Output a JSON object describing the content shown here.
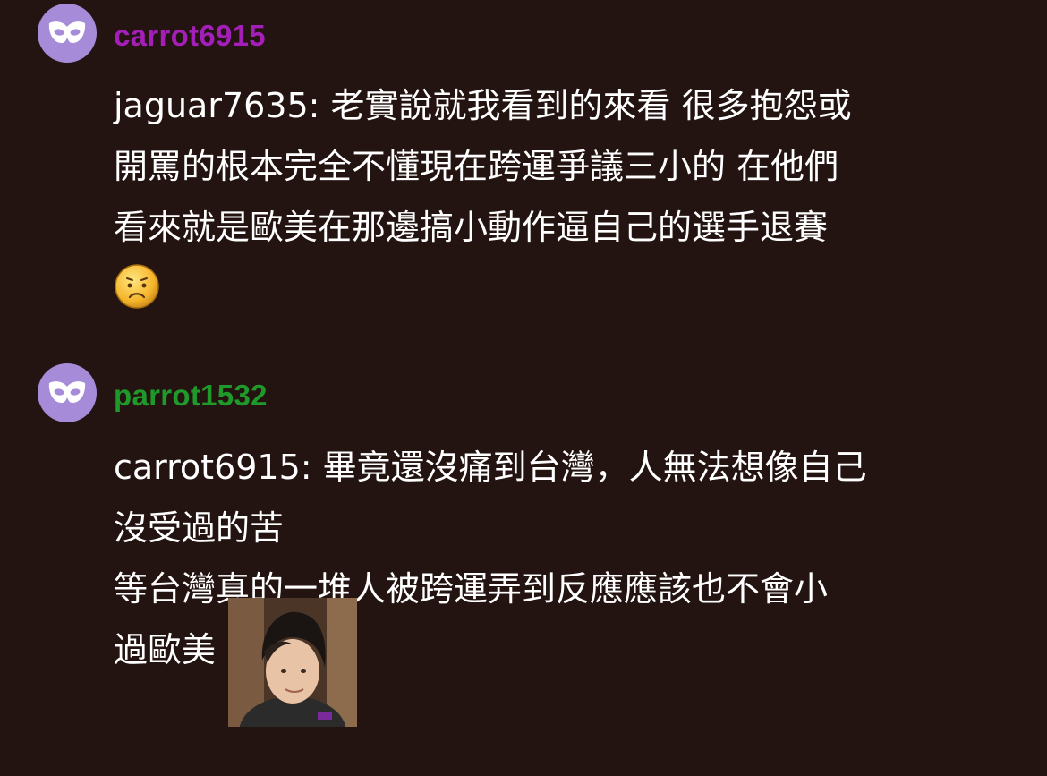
{
  "comments": [
    {
      "username": "carrot6915",
      "username_color": "#a31fb8",
      "avatar_icon": "mask-icon",
      "lines": [
        "jaguar7635: 老實說就我看到的來看 很多抱怨或",
        "開罵的根本完全不懂現在跨運爭議三小的 在他們",
        "看來就是歐美在那邊搞小動作逼自己的選手退賽"
      ],
      "emoji": "worried-face-emoji"
    },
    {
      "username": "parrot1532",
      "username_color": "#1f9a2a",
      "avatar_icon": "mask-icon",
      "lines": [
        "carrot6915: 畢竟還沒痛到台灣，人無法想像自己",
        "沒受過的苦",
        "等台灣真的一堆人被跨運弄到反應應該也不會小",
        "過歐美"
      ],
      "image": "reaction-photo"
    }
  ],
  "colors": {
    "background": "#231311",
    "text": "#ffffff",
    "avatar": "#a58bd8"
  }
}
